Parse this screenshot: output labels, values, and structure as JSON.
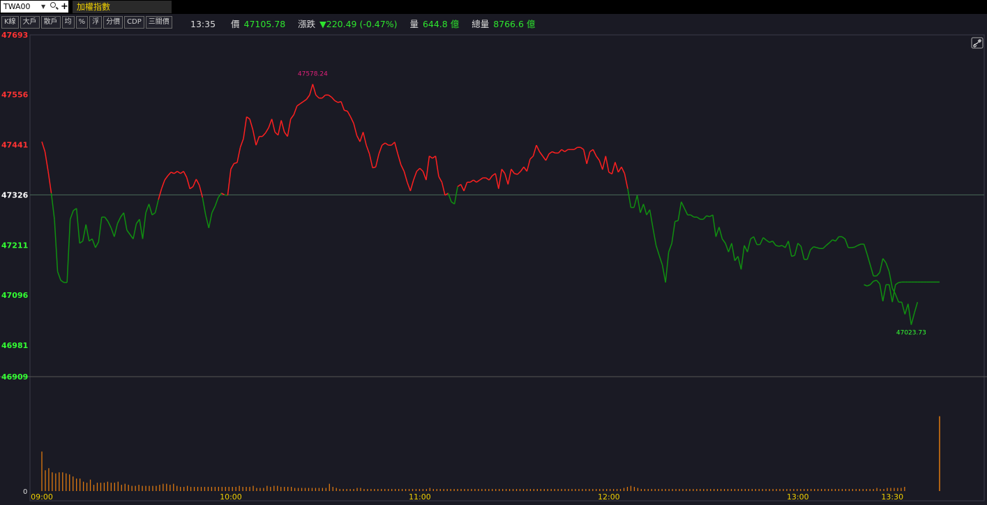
{
  "header": {
    "symbol": "TWA00",
    "index_name": "加權指數"
  },
  "toolbar": {
    "buttons": [
      "K線",
      "大戶",
      "散戶",
      "均",
      "%",
      "浮",
      "分價",
      "CDP",
      "三關價"
    ]
  },
  "quote": {
    "time": "13:35",
    "price_label": "價",
    "price": "47105.78",
    "change_label": "漲跌",
    "change": "▼220.49 (-0.47%)",
    "volume_label": "量",
    "volume": "644.8 億",
    "total_volume_label": "總量",
    "total_volume": "8766.6 億"
  },
  "icons": {
    "link": "link-icon",
    "search": "search-icon",
    "dropdown": "chevron-down-icon",
    "add": "plus-icon"
  },
  "colors": {
    "up": "#ff2020",
    "down": "#109010",
    "axis_up_label": "#ff3333",
    "axis_down_label": "#33ff33",
    "reference_label": "#ffffff",
    "volume": "#e07a10",
    "high_label": "#e0207a",
    "low_label": "#33ff33",
    "background": "#1a1a24"
  },
  "chart_data": {
    "type": "line",
    "reference_price": 47326,
    "ylim": [
      46909,
      47693
    ],
    "y_ticks": [
      "47693",
      "47556",
      "47441",
      "47326",
      "47211",
      "47096",
      "46981",
      "46909"
    ],
    "x_ticks": [
      "09:00",
      "10:00",
      "11:00",
      "12:00",
      "13:00",
      "13:30"
    ],
    "x_range_minutes": [
      0,
      285
    ],
    "high_label": "47578.24",
    "low_label": "47023.73",
    "volume_axis_label": "0",
    "price_series": {
      "t": [
        0,
        1,
        2,
        3,
        4,
        5,
        6,
        7,
        8,
        9,
        10,
        11,
        12,
        13,
        14,
        15,
        16,
        17,
        18,
        19,
        20,
        21,
        22,
        23,
        24,
        25,
        26,
        27,
        28,
        29,
        30,
        31,
        32,
        33,
        34,
        35,
        36,
        37,
        38,
        39,
        40,
        41,
        42,
        43,
        44,
        45,
        46,
        47,
        48,
        49,
        50,
        51,
        52,
        53,
        54,
        55,
        56,
        57,
        58,
        59,
        60,
        61,
        62,
        63,
        64,
        65,
        66,
        67,
        68,
        69,
        70,
        71,
        72,
        73,
        74,
        75,
        76,
        77,
        78,
        79,
        80,
        81,
        82,
        83,
        84,
        85,
        86,
        87,
        88,
        89,
        90,
        91,
        92,
        93,
        94,
        95,
        96,
        97,
        98,
        99,
        100,
        101,
        102,
        103,
        104,
        105,
        106,
        107,
        108,
        109,
        110,
        111,
        112,
        113,
        114,
        115,
        116,
        117,
        118,
        119,
        120,
        121,
        122,
        123,
        124,
        125,
        126,
        127,
        128,
        129,
        130,
        131,
        132,
        133,
        134,
        135,
        136,
        137,
        138,
        139,
        140,
        141,
        142,
        143,
        144,
        145,
        146,
        147,
        148,
        149,
        150,
        151,
        152,
        153,
        154,
        155,
        156,
        157,
        158,
        159,
        160,
        161,
        162,
        163,
        164,
        165,
        166,
        167,
        168,
        169,
        170,
        171,
        172,
        173,
        174,
        175,
        176,
        177,
        178,
        179,
        180,
        181,
        182,
        183,
        184,
        185,
        186,
        187,
        188,
        189,
        190,
        191,
        192,
        193,
        194,
        195,
        196,
        197,
        198,
        199,
        200,
        201,
        202,
        203,
        204,
        205,
        206,
        207,
        208,
        209,
        210,
        211,
        212,
        213,
        214,
        215,
        216,
        217,
        218,
        219,
        220,
        221,
        222,
        223,
        224,
        225,
        226,
        227,
        228,
        229,
        230,
        231,
        232,
        233,
        234,
        235,
        236,
        237,
        238,
        239,
        240,
        241,
        242,
        243,
        244,
        245,
        246,
        247,
        248,
        249,
        250,
        251,
        252,
        253,
        254,
        255,
        256,
        257,
        258,
        259,
        260,
        261,
        262,
        263,
        264,
        265,
        266,
        267,
        268,
        269,
        270,
        271,
        272,
        273,
        274,
        275,
        276,
        277,
        278
      ],
      "price": [
        47448,
        47425,
        47380,
        47330,
        47270,
        47150,
        47130,
        47125,
        47125,
        47270,
        47290,
        47295,
        47215,
        47220,
        47258,
        47220,
        47225,
        47205,
        47218,
        47275,
        47275,
        47265,
        47250,
        47230,
        47260,
        47275,
        47285,
        47245,
        47235,
        47225,
        47260,
        47270,
        47225,
        47285,
        47305,
        47280,
        47285,
        47315,
        47340,
        47360,
        47370,
        47378,
        47375,
        47380,
        47375,
        47380,
        47366,
        47340,
        47345,
        47362,
        47348,
        47320,
        47280,
        47250,
        47285,
        47300,
        47320,
        47330,
        47326,
        47325,
        47385,
        47398,
        47400,
        47435,
        47455,
        47505,
        47500,
        47475,
        47440,
        47460,
        47460,
        47468,
        47480,
        47500,
        47470,
        47463,
        47497,
        47470,
        47460,
        47500,
        47510,
        47530,
        47535,
        47540,
        47545,
        47555,
        47580,
        47555,
        47548,
        47548,
        47555,
        47555,
        47550,
        47542,
        47538,
        47540,
        47520,
        47518,
        47505,
        47490,
        47462,
        47448,
        47470,
        47440,
        47420,
        47388,
        47390,
        47420,
        47440,
        47445,
        47440,
        47440,
        47447,
        47420,
        47395,
        47380,
        47355,
        47335,
        47360,
        47380,
        47387,
        47380,
        47360,
        47415,
        47410,
        47415,
        47368,
        47355,
        47325,
        47330,
        47310,
        47305,
        47345,
        47350,
        47335,
        47355,
        47355,
        47360,
        47355,
        47360,
        47365,
        47365,
        47360,
        47370,
        47375,
        47340,
        47385,
        47375,
        47350,
        47385,
        47375,
        47373,
        47380,
        47390,
        47380,
        47408,
        47415,
        47440,
        47425,
        47415,
        47405,
        47420,
        47425,
        47422,
        47422,
        47430,
        47425,
        47430,
        47430,
        47430,
        47435,
        47435,
        47430,
        47397,
        47425,
        47430,
        47415,
        47405,
        47384,
        47415,
        47378,
        47374,
        47401,
        47378,
        47390,
        47375,
        47340,
        47297,
        47297,
        47325,
        47285,
        47305,
        47280,
        47292,
        47250,
        47210,
        47187,
        47165,
        47125,
        47195,
        47215,
        47265,
        47267,
        47310,
        47295,
        47280,
        47280,
        47275,
        47275,
        47270,
        47270,
        47278,
        47276,
        47280,
        47230,
        47252,
        47225,
        47215,
        47195,
        47215,
        47175,
        47185,
        47155,
        47210,
        47195,
        47225,
        47230,
        47212,
        47212,
        47228,
        47222,
        47217,
        47220,
        47210,
        47208,
        47210,
        47205,
        47220,
        47185,
        47187,
        47215,
        47208,
        47178,
        47178,
        47200,
        47207,
        47205,
        47203,
        47203,
        47210,
        47216,
        47223,
        47220,
        47230,
        47230,
        47225,
        47205,
        47205,
        47206,
        47210,
        47213,
        47213,
        47190,
        47165,
        47140,
        47140,
        47148,
        47180,
        47170,
        47150,
        47112,
        47098,
        47080,
        47080,
        47052,
        47076,
        47028,
        47055,
        47080,
        47090,
        47120
      ]
    },
    "price_series_tail": {
      "t": [
        261,
        262,
        263,
        264,
        265,
        266,
        267,
        268,
        269,
        270,
        271,
        272,
        273,
        274,
        275,
        276,
        277,
        278,
        279,
        280,
        281,
        282,
        283,
        284,
        285
      ],
      "price": [
        47120,
        47117,
        47120,
        47128,
        47130,
        47122,
        47082,
        47120,
        47120,
        47080,
        47120,
        47125,
        47126,
        47126,
        47126,
        47126,
        47126,
        47126,
        47126,
        47126,
        47126,
        47126,
        47126,
        47126,
        47126
      ]
    },
    "volume_series": {
      "t_step": 1.1,
      "relative_values": [
        0.38,
        0.2,
        0.22,
        0.18,
        0.17,
        0.18,
        0.18,
        0.17,
        0.16,
        0.14,
        0.12,
        0.12,
        0.09,
        0.08,
        0.11,
        0.06,
        0.08,
        0.08,
        0.08,
        0.09,
        0.08,
        0.08,
        0.09,
        0.06,
        0.07,
        0.06,
        0.05,
        0.05,
        0.06,
        0.05,
        0.05,
        0.05,
        0.05,
        0.05,
        0.06,
        0.07,
        0.07,
        0.06,
        0.07,
        0.05,
        0.04,
        0.04,
        0.05,
        0.04,
        0.04,
        0.04,
        0.04,
        0.04,
        0.04,
        0.04,
        0.04,
        0.04,
        0.04,
        0.04,
        0.04,
        0.04,
        0.04,
        0.05,
        0.04,
        0.04,
        0.04,
        0.05,
        0.03,
        0.03,
        0.03,
        0.05,
        0.04,
        0.05,
        0.05,
        0.04,
        0.04,
        0.04,
        0.04,
        0.03,
        0.03,
        0.03,
        0.03,
        0.03,
        0.03,
        0.03,
        0.03,
        0.03,
        0.03,
        0.07,
        0.04,
        0.03,
        0.02,
        0.02,
        0.02,
        0.02,
        0.02,
        0.03,
        0.03,
        0.02,
        0.02,
        0.02,
        0.02,
        0.02,
        0.02,
        0.02,
        0.02,
        0.02,
        0.02,
        0.02,
        0.02,
        0.02,
        0.02,
        0.02,
        0.02,
        0.02,
        0.02,
        0.02,
        0.03,
        0.02,
        0.02,
        0.02,
        0.02,
        0.02,
        0.02,
        0.02,
        0.02,
        0.02,
        0.02,
        0.02,
        0.02,
        0.02,
        0.02,
        0.02,
        0.02,
        0.02,
        0.02,
        0.02,
        0.02,
        0.02,
        0.02,
        0.02,
        0.02,
        0.02,
        0.02,
        0.02,
        0.02,
        0.02,
        0.02,
        0.02,
        0.02,
        0.02,
        0.02,
        0.02,
        0.02,
        0.02,
        0.02,
        0.02,
        0.02,
        0.02,
        0.02,
        0.02,
        0.02,
        0.02,
        0.02,
        0.02,
        0.02,
        0.02,
        0.02,
        0.02,
        0.02,
        0.02,
        0.02,
        0.02,
        0.03,
        0.04,
        0.05,
        0.04,
        0.03,
        0.02,
        0.02,
        0.02,
        0.02,
        0.02,
        0.02,
        0.02,
        0.02,
        0.02,
        0.02,
        0.02,
        0.02,
        0.02,
        0.02,
        0.02,
        0.02,
        0.02,
        0.02,
        0.02,
        0.02,
        0.02,
        0.02,
        0.02,
        0.02,
        0.02,
        0.02,
        0.02,
        0.02,
        0.02,
        0.02,
        0.02,
        0.02,
        0.02,
        0.02,
        0.02,
        0.02,
        0.02,
        0.02,
        0.02,
        0.02,
        0.02,
        0.02,
        0.02,
        0.02,
        0.02,
        0.02,
        0.02,
        0.02,
        0.02,
        0.02,
        0.02,
        0.02,
        0.02,
        0.02,
        0.02,
        0.02,
        0.02,
        0.02,
        0.02,
        0.02,
        0.02,
        0.02,
        0.02,
        0.02,
        0.02,
        0.02,
        0.02,
        0.02,
        0.03,
        0.02,
        0.02,
        0.03,
        0.03,
        0.03,
        0.03,
        0.03,
        0.04,
        0.05,
        0.04,
        0.05,
        0.04,
        0.04,
        0.04,
        0.03,
        0.03,
        0.03,
        0.03,
        0.04,
        0.05,
        0.06
      ],
      "closing_spike": 0.6
    }
  }
}
